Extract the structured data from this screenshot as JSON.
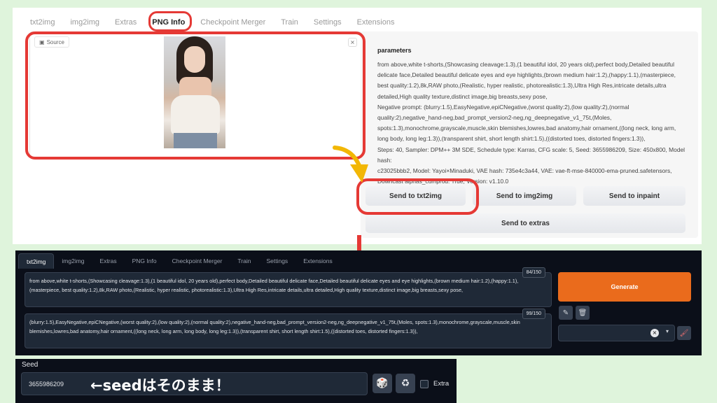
{
  "top": {
    "tabs": [
      "txt2img",
      "img2img",
      "Extras",
      "PNG Info",
      "Checkpoint Merger",
      "Train",
      "Settings",
      "Extensions"
    ],
    "active_tab": "PNG Info",
    "source_label": "Source",
    "close_glyph": "×",
    "params_title": "parameters",
    "params_lines": [
      "from above,white t-shorts,(Showcasing cleavage:1.3),(1 beautiful idol, 20 years old),perfect body,Detailed beautiful",
      "delicate face,Detailed beautiful delicate eyes and eye highlights,(brown medium hair:1.2),(happy:1.1),(masterpiece,",
      "best quality:1.2),8k,RAW photo,(Realistic, hyper realistic, photorealistic:1.3),Ultra High Res,intricate details,ultra",
      "detailed,High quality texture,distinct image,big breasts,sexy pose,",
      "Negative prompt: (blurry:1.5),EasyNegative,epiCNegative,(worst quality:2),(low quality:2),(normal",
      "quality:2),negative_hand-neg,bad_prompt_version2-neg,ng_deepnegative_v1_75t,(Moles,",
      "spots:1.3),monochrome,grayscale,muscle,skin blemishes,lowres,bad anatomy,hair ornament,((long neck, long arm,",
      "long body, long leg:1.3)),(transparent shirt, short length shirt:1.5),((distorted toes, distorted fingers:1.3)),",
      "Steps: 40, Sampler: DPM++ 3M SDE, Schedule type: Karras, CFG scale: 5, Seed: 3655986209, Size: 450x800, Model hash:",
      "c23025bbb2, Model: Yayoi×Minaduki, VAE hash: 735e4c3a44, VAE: vae-ft-mse-840000-ema-pruned.safetensors,",
      "Downcast alphas_cumprod: True, Version: v1.10.0"
    ],
    "buttons": {
      "send_txt2img": "Send to txt2img",
      "send_img2img": "Send to img2img",
      "send_inpaint": "Send to inpaint",
      "send_extras": "Send to extras"
    }
  },
  "dark": {
    "tabs": [
      "txt2img",
      "img2img",
      "Extras",
      "PNG Info",
      "Checkpoint Merger",
      "Train",
      "Settings",
      "Extensions"
    ],
    "active_tab": "txt2img",
    "prompt": "from above,white t-shorts,(Showcasing cleavage:1.3),(1 beautiful idol, 20 years old),perfect body,Detailed beautiful delicate face,Detailed beautiful delicate eyes and eye highlights,(brown medium hair:1.2),(happy:1.1),(masterpiece, best quality:1.2),8k,RAW photo,(Realistic, hyper realistic, photorealistic:1.3),Ultra High Res,intricate details,ultra detailed,High quality texture,distinct image,big breasts,sexy pose,",
    "prompt_counter": "84/150",
    "negative_prompt": "(blurry:1.5),EasyNegative,epiCNegative,(worst quality:2),(low quality:2),(normal quality:2),negative_hand-neg,bad_prompt_version2-neg,ng_deepnegative_v1_75t,(Moles, spots:1.3),monochrome,grayscale,muscle,skin blemishes,lowres,bad anatomy,hair ornament,((long neck, long arm, long body, long leg:1.3)),(transparent shirt, short length shirt:1.5),((distorted toes, distorted fingers:1.3)),",
    "negative_counter": "99/150",
    "generate_label": "Generate",
    "edit_glyph": "✎",
    "trash_glyph": "🗑",
    "clear_glyph": "×",
    "caret_glyph": "▾",
    "brush_glyph": "🖌"
  },
  "seed": {
    "label": "Seed",
    "value": "3655986209",
    "annotation": "←seedはそのまま！",
    "dice_glyph": "🎲",
    "recycle_glyph": "♻",
    "extra_label": "Extra"
  },
  "colors": {
    "annotation_red": "#e53935",
    "arrow_orange": "#f2b705",
    "generate_orange": "#ea6b1c",
    "dark_bg": "#0b0f19"
  }
}
